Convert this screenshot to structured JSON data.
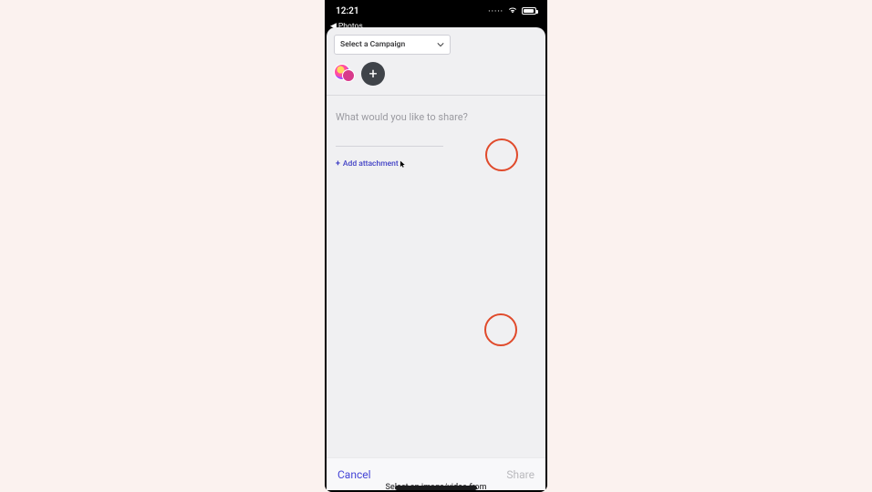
{
  "statusBar": {
    "time": "12:21",
    "backLink": "Photos",
    "signal": "·····",
    "wifi": "wifi",
    "battery": "battery"
  },
  "campaign": {
    "placeholder": "Select a Campaign"
  },
  "compose": {
    "placeholder": "What would you like to share?"
  },
  "attachment": {
    "label": "Add attachment"
  },
  "footer": {
    "cancel": "Cancel",
    "share": "Share"
  },
  "toast": {
    "text": "Select an image/video from"
  }
}
